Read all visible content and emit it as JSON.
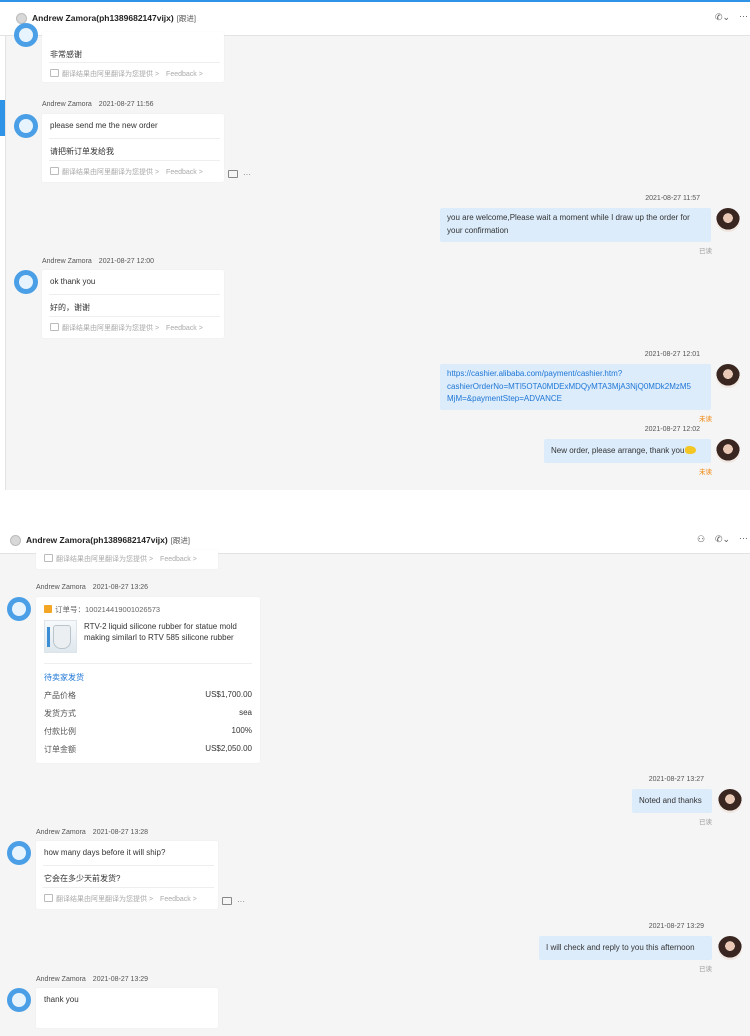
{
  "window": {
    "contact_name": "Andrew Zamora(ph1389682147vijx)",
    "contact_tag": "[跟进]"
  },
  "icons": {
    "phone": "phone-icon",
    "more": "more-icon",
    "user_add": "user-add-icon"
  },
  "colors": {
    "accent": "#2f94e8",
    "bubble": "#dcecfb",
    "unread": "#f08000",
    "link": "#1e76d6"
  },
  "translation": {
    "note": "翻译结果由阿里翻译为您提供",
    "arrow": ">",
    "feedback": "Feedback",
    "feedback_arrow": ">"
  },
  "tools_more": "···",
  "panel1": {
    "m0_translation": "非常感谢",
    "m1": {
      "sender": "Andrew Zamora",
      "time": "2021-08-27 11:56",
      "text": "please send me the new order",
      "translation": "请把新订单发给我"
    },
    "m2": {
      "time": "2021-08-27 11:57",
      "line1": "you are welcome,Please wait a moment while I draw up the order for",
      "line2": "your confirmation",
      "status": "已读"
    },
    "m3": {
      "sender": "Andrew Zamora",
      "time": "2021-08-27 12:00",
      "text": "ok thank you",
      "translation": "好的，谢谢"
    },
    "m4": {
      "time": "2021-08-27 12:01",
      "line1": "https://cashier.alibaba.com/payment/cashier.htm?",
      "line2": "cashierOrderNo=MTI5OTA0MDExMDQyMTA3MjA3NjQ0MDk2MzM5",
      "line3": "MjM=&paymentStep=ADVANCE",
      "status": "未读"
    },
    "m5": {
      "time": "2021-08-27 12:02",
      "text": "New order, please arrange, thank you",
      "status": "未读"
    }
  },
  "panel2": {
    "o1": {
      "sender": "Andrew Zamora",
      "time": "2021-08-27 13:26",
      "order_no_label": "订单号：",
      "order_no": "100214419001026573",
      "product_line1": "RTV-2 liquid silicone rubber for statue mold",
      "product_line2": "making similarl to RTV 585 silicone rubber",
      "status": "待卖家发货",
      "rows": [
        {
          "k": "产品价格",
          "v": "US$1,700.00"
        },
        {
          "k": "发货方式",
          "v": "sea"
        },
        {
          "k": "付款比例",
          "v": "100%"
        },
        {
          "k": "订单金额",
          "v": "US$2,050.00"
        }
      ]
    },
    "m1": {
      "time": "2021-08-27 13:27",
      "text": "Noted and thanks",
      "status": "已读"
    },
    "m2": {
      "sender": "Andrew Zamora",
      "time": "2021-08-27 13:28",
      "text": "how many days before it will ship?",
      "translation": "它会在多少天前发货?"
    },
    "m3": {
      "time": "2021-08-27 13:29",
      "text": "I will check and reply to you this afternoon",
      "status": "已读"
    },
    "m4": {
      "sender": "Andrew Zamora",
      "time": "2021-08-27 13:29",
      "text": "thank you"
    }
  }
}
